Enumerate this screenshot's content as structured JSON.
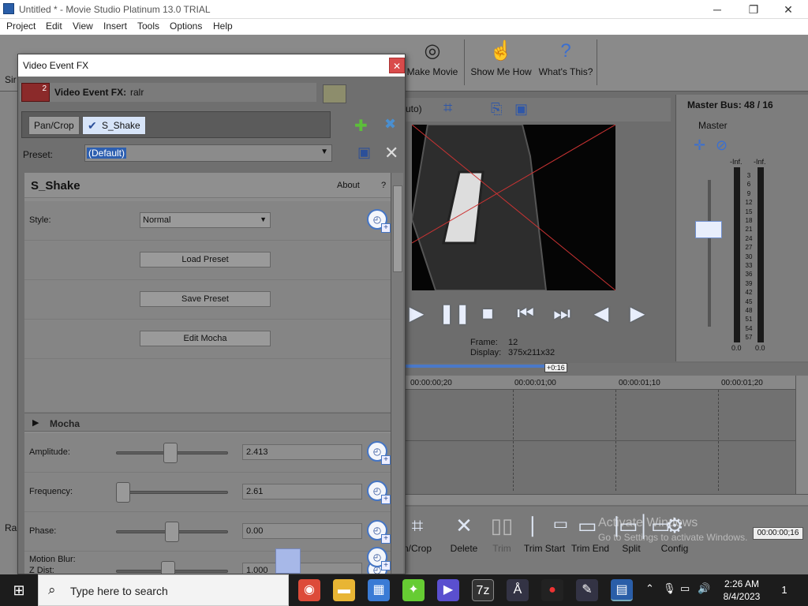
{
  "titlebar": {
    "title": "Untitled * - Movie Studio Platinum 13.0 TRIAL",
    "minimize": "─",
    "maximize": "❐",
    "close": "✕"
  },
  "menu": [
    "Project",
    "Edit",
    "View",
    "Insert",
    "Tools",
    "Options",
    "Help"
  ],
  "toolbar": {
    "make_movie": "Make Movie",
    "show_me_how": "Show Me How",
    "whats_this": "What's This?",
    "left_partial": "Sir"
  },
  "preview": {
    "mode_label": "uto)",
    "frame_label": "Frame:",
    "frame_value": "12",
    "display_label": "Display:",
    "display_value": "375x211x32"
  },
  "masterbus": {
    "title": "Master Bus:",
    "level": "48 / 16",
    "master_label": "Master",
    "peak_left": "-Inf.",
    "peak_right": "-Inf.",
    "scale": [
      "3",
      "6",
      "9",
      "12",
      "15",
      "18",
      "21",
      "24",
      "27",
      "30",
      "33",
      "36",
      "39",
      "42",
      "45",
      "48",
      "51",
      "54",
      "57"
    ],
    "bottom_left": "0.0",
    "bottom_right": "0.0"
  },
  "timeline": {
    "cursor_badge": "+0:16",
    "ticks": [
      "00:00:00;20",
      "00:00:01;00",
      "00:00:01;10",
      "00:00:01;20"
    ],
    "time_display": "00:00:00;16"
  },
  "bottombar": {
    "pan_crop": "n/Crop",
    "delete": "Delete",
    "trim": "Trim",
    "trim_start": "Trim Start",
    "trim_end": "Trim End",
    "split": "Split",
    "config": "Config"
  },
  "watermark": {
    "line1": "Activate Windows",
    "line2": "Go to Settings to activate Windows."
  },
  "left_partial": "Ra",
  "dialog": {
    "title": "Video Event FX",
    "close": "✕",
    "fx_label": "Video Event FX:",
    "fx_name": "ralr",
    "fx_count": "2",
    "chain": [
      "Pan/Crop",
      "S_Shake"
    ],
    "preset_label": "Preset:",
    "preset_value": "(Default)",
    "plugin": {
      "name": "S_Shake",
      "about": "About",
      "help": "?",
      "style_label": "Style:",
      "style_value": "Normal",
      "load_preset": "Load Preset",
      "save_preset": "Save Preset",
      "edit_mocha": "Edit Mocha",
      "mocha_section": "Mocha",
      "params": [
        {
          "label": "Amplitude:",
          "value": "2.413",
          "fraction": 0.48
        },
        {
          "label": "Frequency:",
          "value": "2.61",
          "fraction": 0.0
        },
        {
          "label": "Phase:",
          "value": "0.00",
          "fraction": 0.5
        },
        {
          "label": "Z Dist:",
          "value": "1.000",
          "fraction": 0.46
        }
      ],
      "motion_blur_label": "Motion Blur:"
    }
  },
  "taskbar": {
    "search_placeholder": "Type here to search",
    "time": "2:26 AM",
    "date": "8/4/2023",
    "notifications": "1"
  }
}
